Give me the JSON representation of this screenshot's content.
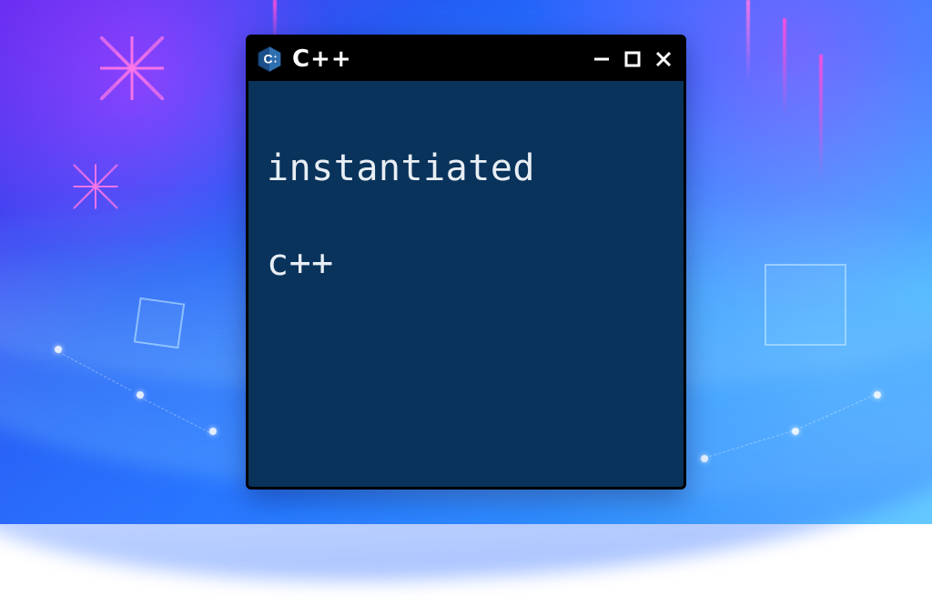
{
  "window": {
    "title": "C++",
    "icon_name": "cpp-icon"
  },
  "content": {
    "line1": "instantiated",
    "line2": "c++"
  },
  "colors": {
    "window_bg": "#09335b",
    "titlebar_bg": "#000000",
    "text": "#e8eef4"
  }
}
